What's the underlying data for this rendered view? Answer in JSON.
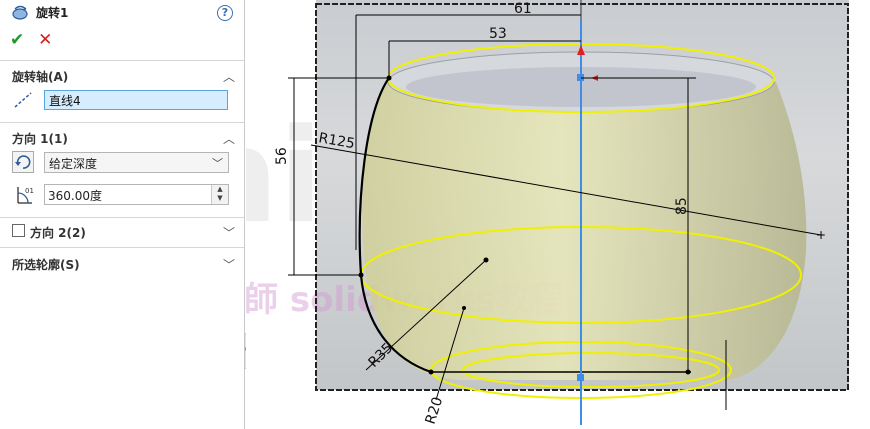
{
  "header": {
    "title": "旋转1",
    "help_symbol": "?"
  },
  "actions": {
    "ok_symbol": "✔",
    "cancel_symbol": "✕"
  },
  "axis_section": {
    "title": "旋转轴(A)",
    "field_value": "直线4"
  },
  "direction1": {
    "title": "方向 1(1)",
    "type_value": "给定深度",
    "angle_value": "360.00度"
  },
  "direction2": {
    "title": "方向 2(2)"
  },
  "contours": {
    "title": "所选轮廓(S)"
  },
  "viewport": {
    "dimensions": {
      "d61": "61",
      "d53": "53",
      "d56": "56",
      "d85": "85",
      "r125": "R125",
      "r35": "R35",
      "r20": "R20"
    },
    "watermark": {
      "text": "泥老師 solidworks教程"
    }
  },
  "colors": {
    "accent": "#59a5de",
    "sketch_yellow": "#f0f000",
    "axis_blue": "#3e8ee6",
    "ok_green": "#1f9b2c",
    "cancel_red": "#d42020"
  }
}
